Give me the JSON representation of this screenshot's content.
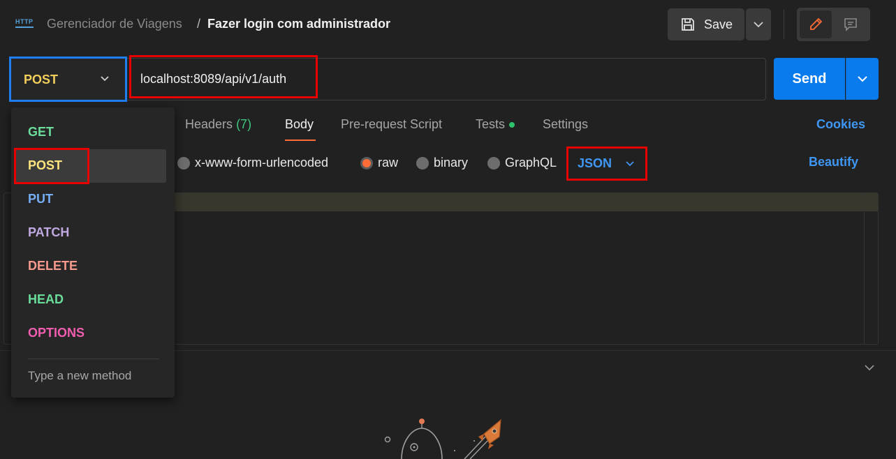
{
  "breadcrumb": {
    "parent": "Gerenciador de Viagens",
    "separator": "/",
    "title": "Fazer login com administrador"
  },
  "toolbar": {
    "save_label": "Save"
  },
  "request": {
    "method": "POST",
    "url": "localhost:8089/api/v1/auth",
    "send_label": "Send"
  },
  "tabs": {
    "headers_label": "Headers",
    "headers_count": "(7)",
    "body": "Body",
    "prerequest": "Pre-request Script",
    "tests": "Tests",
    "settings": "Settings",
    "cookies": "Cookies"
  },
  "body_types": {
    "urlencoded": "x-www-form-urlencoded",
    "raw": "raw",
    "binary": "binary",
    "graphql": "GraphQL",
    "selected": "raw",
    "format": "JSON",
    "beautify": "Beautify"
  },
  "method_dropdown": {
    "items": [
      {
        "label": "GET",
        "color": "#6bdd9a"
      },
      {
        "label": "POST",
        "color": "#ffe47e"
      },
      {
        "label": "PUT",
        "color": "#74aef6"
      },
      {
        "label": "PATCH",
        "color": "#c0a8e1"
      },
      {
        "label": "DELETE",
        "color": "#f79a8e"
      },
      {
        "label": "HEAD",
        "color": "#6bdd9a"
      },
      {
        "label": "OPTIONS",
        "color": "#f15eb0"
      }
    ],
    "selected": "POST",
    "new_method_placeholder": "Type a new method"
  },
  "colors": {
    "accent": "#ff6c37",
    "primary": "#097bed",
    "link": "#3f97f5",
    "annotation": "#e60000"
  }
}
